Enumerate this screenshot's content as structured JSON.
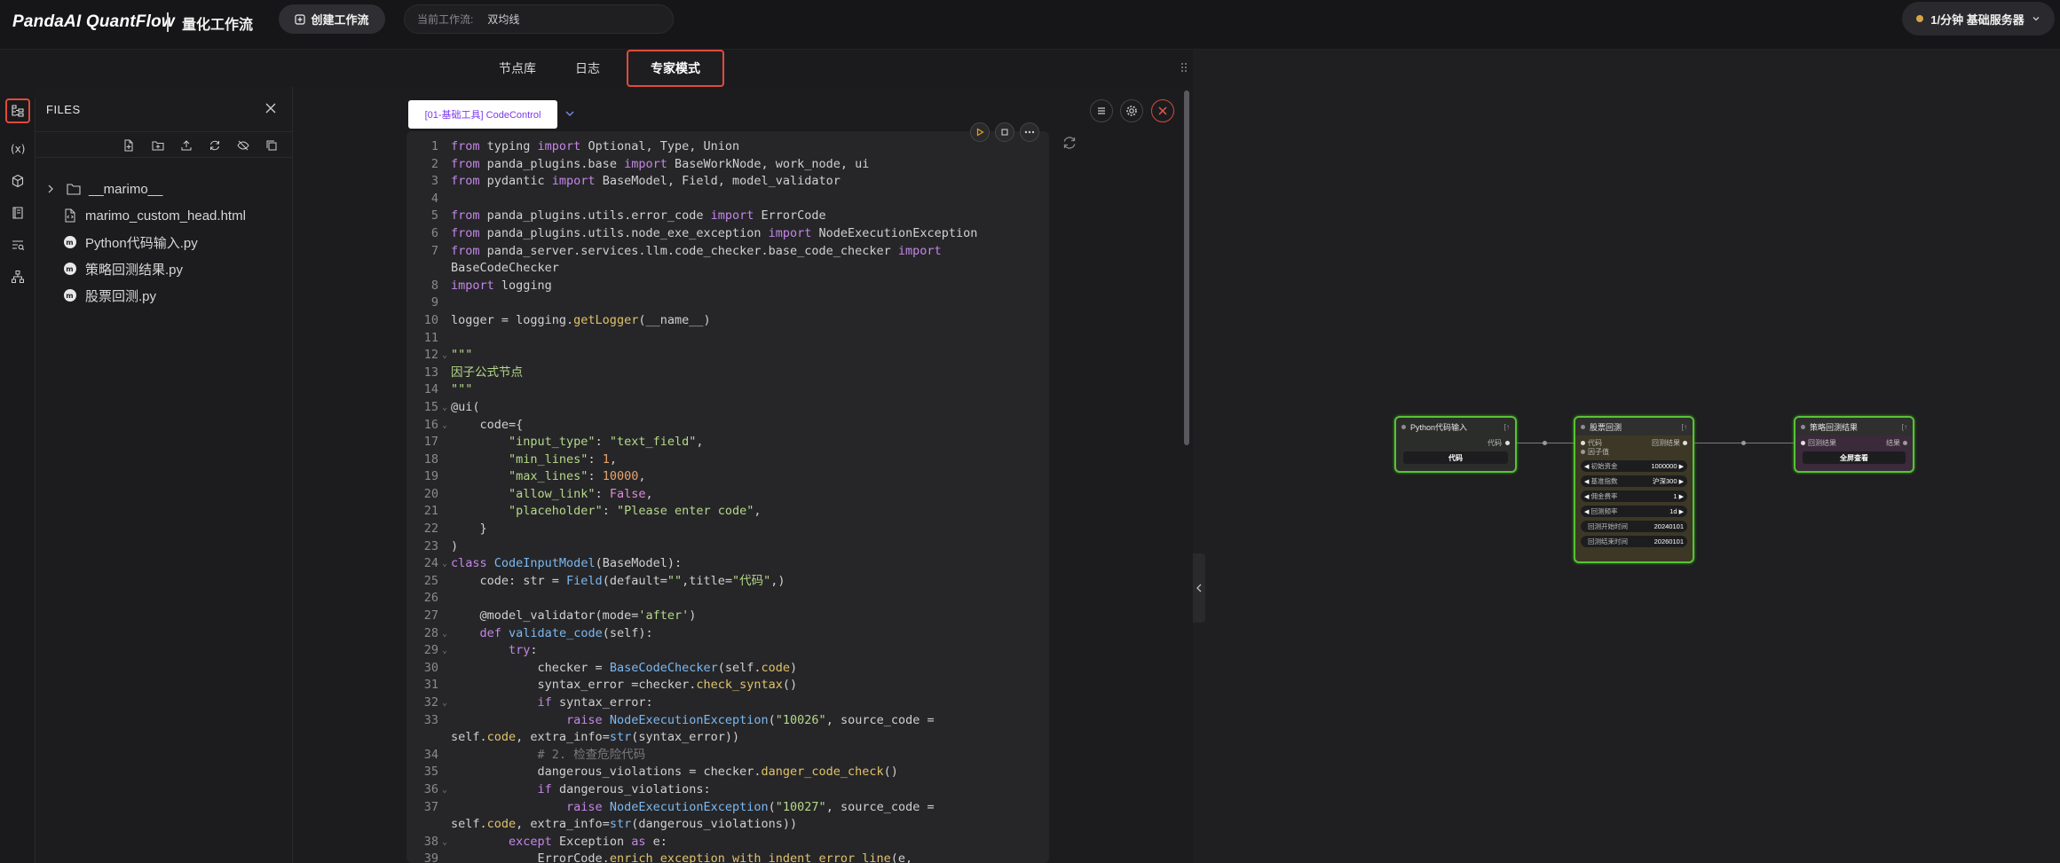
{
  "app": {
    "brand": "PandaAI QuantFlow",
    "subtitle": "量化工作流",
    "create_label": "创建工作流",
    "workflow_label": "当前工作流:",
    "workflow_value": "双均线",
    "server_label": "1/分钟  基础服务器",
    "accent": "#e24a3b"
  },
  "tabs": {
    "nodes": "节点库",
    "logs": "日志",
    "expert": "专家模式"
  },
  "files": {
    "title": "FILES",
    "items": [
      {
        "name": "__marimo__",
        "type": "folder"
      },
      {
        "name": "marimo_custom_head.html",
        "type": "html"
      },
      {
        "name": "Python代码输入.py",
        "type": "py"
      },
      {
        "name": "策略回测结果.py",
        "type": "py"
      },
      {
        "name": "股票回测.py",
        "type": "py"
      }
    ]
  },
  "editor": {
    "tab_label": "[01-基础工具] CodeControl",
    "lines": [
      {
        "n": "1",
        "html": "<span class=\"kw\">from</span> typing <span class=\"kw\">import</span> Optional, Type, Union"
      },
      {
        "n": "2",
        "html": "<span class=\"kw\">from</span> panda_plugins.base <span class=\"kw\">import</span> BaseWorkNode, work_node, ui"
      },
      {
        "n": "3",
        "html": "<span class=\"kw\">from</span> pydantic <span class=\"kw\">import</span> BaseModel, Field, model_validator"
      },
      {
        "n": "4",
        "html": ""
      },
      {
        "n": "5",
        "html": "<span class=\"kw\">from</span> panda_plugins.utils.error_code <span class=\"kw\">import</span> ErrorCode"
      },
      {
        "n": "6",
        "html": "<span class=\"kw\">from</span> panda_plugins.utils.node_exe_exception <span class=\"kw\">import</span> NodeExecutionException"
      },
      {
        "n": "7",
        "html": "<span class=\"kw\">from</span> panda_server.services.llm.code_checker.base_code_checker <span class=\"kw\">import</span>\nBaseCodeChecker",
        "wrap": true
      },
      {
        "n": "8",
        "html": "<span class=\"kw\">import</span> logging"
      },
      {
        "n": "9",
        "html": ""
      },
      {
        "n": "10",
        "html": "logger = logging.<span class=\"fn\">getLogger</span>(__name__)"
      },
      {
        "n": "11",
        "html": ""
      },
      {
        "n": "12",
        "html": "<span class=\"st\">\"\"\"</span>",
        "fold": true
      },
      {
        "n": "13",
        "html": "<span class=\"st\">因子公式节点</span>"
      },
      {
        "n": "14",
        "html": "<span class=\"st\">\"\"\"</span>"
      },
      {
        "n": "15",
        "html": "@ui(",
        "fold": true
      },
      {
        "n": "16",
        "html": "    code={",
        "fold": true
      },
      {
        "n": "17",
        "html": "        <span class=\"st\">\"input_type\"</span>: <span class=\"st\">\"text_field\"</span>,"
      },
      {
        "n": "18",
        "html": "        <span class=\"st\">\"min_lines\"</span>: <span class=\"nm\">1</span>,"
      },
      {
        "n": "19",
        "html": "        <span class=\"st\">\"max_lines\"</span>: <span class=\"nm\">10000</span>,"
      },
      {
        "n": "20",
        "html": "        <span class=\"st\">\"allow_link\"</span>: <span class=\"cn\">False</span>,"
      },
      {
        "n": "21",
        "html": "        <span class=\"st\">\"placeholder\"</span>: <span class=\"st\">\"Please enter code\"</span>,"
      },
      {
        "n": "22",
        "html": "    }"
      },
      {
        "n": "23",
        "html": ")"
      },
      {
        "n": "24",
        "html": "<span class=\"kw\">class</span> <span class=\"cl\">CodeInputModel</span>(BaseModel):",
        "fold": true
      },
      {
        "n": "25",
        "html": "    code: str = <span class=\"cl\">Field</span>(default=<span class=\"st\">\"\"</span>,title=<span class=\"st\">\"代码\"</span>,)"
      },
      {
        "n": "26",
        "html": ""
      },
      {
        "n": "27",
        "html": "    @model_validator(mode=<span class=\"st\">'after'</span>)"
      },
      {
        "n": "28",
        "html": "    <span class=\"kw\">def</span> <span class=\"cl\">validate_code</span>(self):",
        "fold": true
      },
      {
        "n": "29",
        "html": "        <span class=\"kw\">try</span>:",
        "fold": true
      },
      {
        "n": "30",
        "html": "            checker = <span class=\"cl\">BaseCodeChecker</span>(self.<span class=\"fn\">code</span>)"
      },
      {
        "n": "31",
        "html": "            syntax_error =checker.<span class=\"fn\">check_syntax</span>()"
      },
      {
        "n": "32",
        "html": "            <span class=\"kw\">if</span> syntax_error:",
        "fold": true
      },
      {
        "n": "33",
        "html": "                <span class=\"kw\">raise</span> <span class=\"cl\">NodeExecutionException</span>(<span class=\"st\">\"10026\"</span>, source_code =\nself.<span class=\"fn\">code</span>, extra_info=<span class=\"cl\">str</span>(syntax_error))",
        "wrap": true
      },
      {
        "n": "34",
        "html": "            <span class=\"cm\"># 2. 检查危险代码</span>"
      },
      {
        "n": "35",
        "html": "            dangerous_violations = checker.<span class=\"fn\">danger_code_check</span>()"
      },
      {
        "n": "36",
        "html": "            <span class=\"kw\">if</span> dangerous_violations:",
        "fold": true
      },
      {
        "n": "37",
        "html": "                <span class=\"kw\">raise</span> <span class=\"cl\">NodeExecutionException</span>(<span class=\"st\">\"10027\"</span>, source_code =\nself.<span class=\"fn\">code</span>, extra_info=<span class=\"cl\">str</span>(dangerous_violations))",
        "wrap": true
      },
      {
        "n": "38",
        "html": "        <span class=\"kw\">except</span> Exception <span class=\"kw\">as</span> e:",
        "fold": true
      },
      {
        "n": "39",
        "html": "            ErrorCode.<span class=\"fn\">enrich_exception_with_indent_error_line</span>(e,"
      }
    ]
  },
  "nodes": {
    "python_input": {
      "title": "Python代码输入",
      "out_port": "代码",
      "button": "代码"
    },
    "backtest": {
      "title": "股票回测",
      "in_port": "代码",
      "out_port": "回测结果",
      "factor": "因子值",
      "params": [
        {
          "label": "初始资金",
          "value": "1000000",
          "arrows": true
        },
        {
          "label": "基准指数",
          "value": "沪深300",
          "arrows": true
        },
        {
          "label": "佣金费率",
          "value": "1",
          "arrows": true
        },
        {
          "label": "回测频率",
          "value": "1d",
          "arrows": true
        },
        {
          "label": "回测开始时间",
          "value": "20240101",
          "arrows": false
        },
        {
          "label": "回测结束时间",
          "value": "20260101",
          "arrows": false
        }
      ]
    },
    "result": {
      "title": "策略回测结果",
      "in_port": "回测结果",
      "out_port": "结果",
      "button": "全屏查看"
    }
  }
}
